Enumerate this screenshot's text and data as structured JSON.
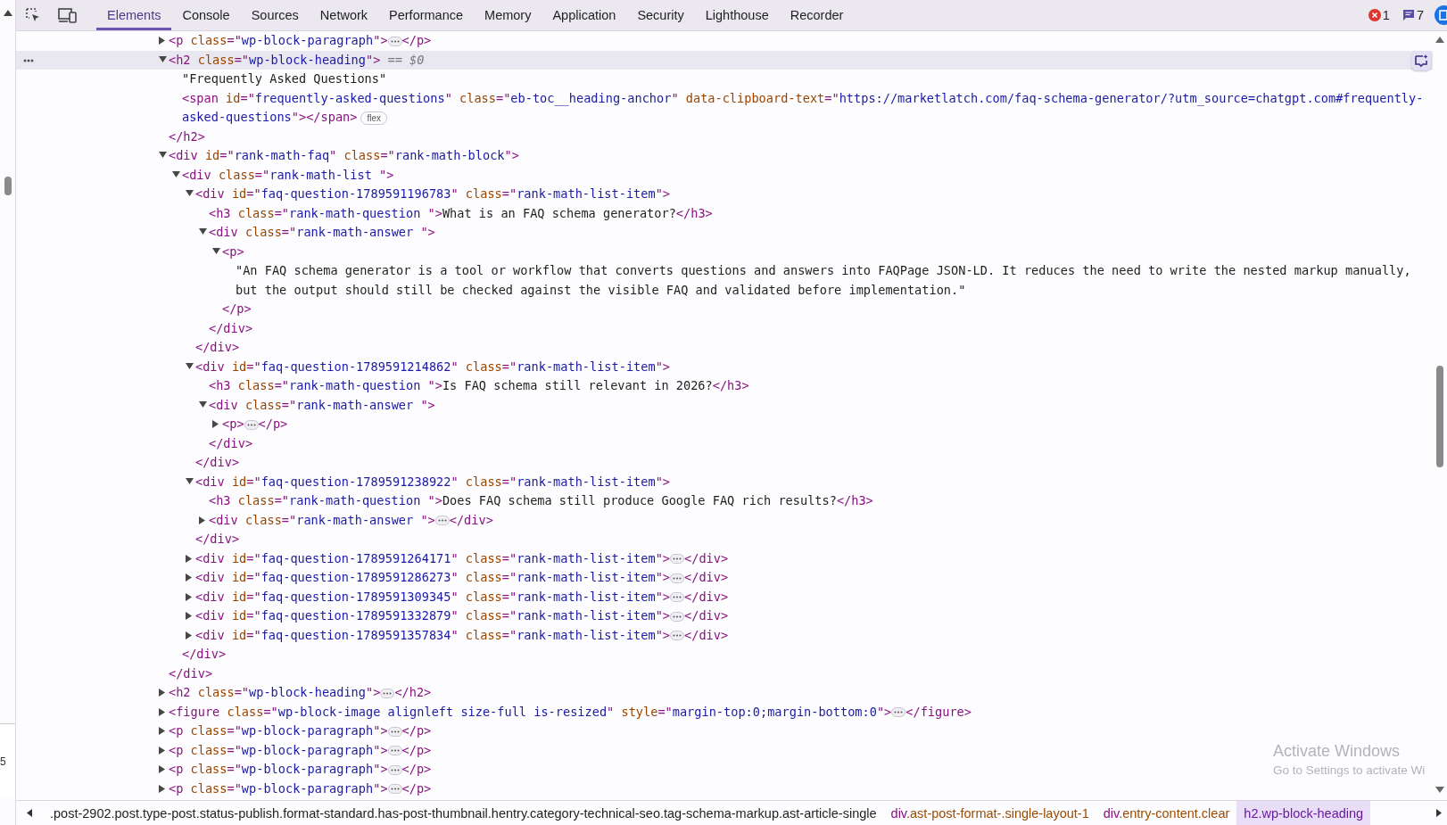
{
  "toolbar": {
    "tabs": [
      {
        "label": "Elements",
        "selected": true
      },
      {
        "label": "Console",
        "selected": false
      },
      {
        "label": "Sources",
        "selected": false
      },
      {
        "label": "Network",
        "selected": false
      },
      {
        "label": "Performance",
        "selected": false
      },
      {
        "label": "Memory",
        "selected": false
      },
      {
        "label": "Application",
        "selected": false
      },
      {
        "label": "Security",
        "selected": false
      },
      {
        "label": "Lighthouse",
        "selected": false
      },
      {
        "label": "Recorder",
        "selected": false
      }
    ],
    "errors": "1",
    "messages": "7"
  },
  "tree": [
    {
      "kind": "element",
      "open": "<p class=\"wp-block-paragraph\">",
      "close": "</p>",
      "expanded": false,
      "selected": false
    },
    {
      "kind": "element",
      "open": "<h2 class=\"wp-block-heading\">",
      "close": "</h2>",
      "expanded": true,
      "selected": true,
      "marker": "== $0",
      "children": [
        {
          "kind": "text",
          "text": "\"Frequently Asked Questions\"",
          "selected": false
        },
        {
          "kind": "inline",
          "open": "<span id=\"frequently-asked-questions\" class=\"eb-toc__heading-anchor\" data-clipboard-text=\"https://marketlatch.com/faq-schema-generator/?utm_source=chatgpt.com#frequently-asked-questions\">",
          "close": "</span>",
          "badge": "flex",
          "selected": false
        }
      ]
    },
    {
      "kind": "element",
      "open": "<div id=\"rank-math-faq\" class=\"rank-math-block\">",
      "close": "</div>",
      "expanded": true,
      "selected": false,
      "children": [
        {
          "kind": "element",
          "open": "<div class=\"rank-math-list \">",
          "close": "</div>",
          "expanded": true,
          "selected": false,
          "children": [
            {
              "kind": "element",
              "open": "<div id=\"faq-question-1789591196783\" class=\"rank-math-list-item\">",
              "close": "</div>",
              "expanded": true,
              "selected": false,
              "children": [
                {
                  "kind": "inline",
                  "open": "<h3 class=\"rank-math-question \">",
                  "text": "What is an FAQ schema generator?",
                  "close": "</h3>",
                  "selected": false
                },
                {
                  "kind": "element",
                  "open": "<div class=\"rank-math-answer \">",
                  "close": "</div>",
                  "expanded": true,
                  "selected": false,
                  "children": [
                    {
                      "kind": "element",
                      "open": "<p>",
                      "close": "</p>",
                      "expanded": true,
                      "selected": false,
                      "children": [
                        {
                          "kind": "text",
                          "text": "\"An FAQ schema generator is a tool or workflow that converts questions and answers into FAQPage JSON-LD. It reduces the need to write the nested markup manually, but the output should still be checked against the visible FAQ and validated before implementation.\"",
                          "selected": false
                        }
                      ]
                    }
                  ]
                }
              ]
            },
            {
              "kind": "element",
              "open": "<div id=\"faq-question-1789591214862\" class=\"rank-math-list-item\">",
              "close": "</div>",
              "expanded": true,
              "selected": false,
              "children": [
                {
                  "kind": "inline",
                  "open": "<h3 class=\"rank-math-question \">",
                  "text": "Is FAQ schema still relevant in 2026?",
                  "close": "</h3>",
                  "selected": false
                },
                {
                  "kind": "element",
                  "open": "<div class=\"rank-math-answer \">",
                  "close": "</div>",
                  "expanded": true,
                  "selected": false,
                  "children": [
                    {
                      "kind": "element",
                      "open": "<p>",
                      "close": "</p>",
                      "expanded": false,
                      "selected": false
                    }
                  ]
                }
              ]
            },
            {
              "kind": "element",
              "open": "<div id=\"faq-question-1789591238922\" class=\"rank-math-list-item\">",
              "close": "</div>",
              "expanded": true,
              "selected": false,
              "children": [
                {
                  "kind": "inline",
                  "open": "<h3 class=\"rank-math-question \">",
                  "text": "Does FAQ schema still produce Google FAQ rich results?",
                  "close": "</h3>",
                  "selected": false
                },
                {
                  "kind": "element",
                  "open": "<div class=\"rank-math-answer \">",
                  "close": "</div>",
                  "expanded": false,
                  "selected": false
                }
              ]
            },
            {
              "kind": "element",
              "open": "<div id=\"faq-question-1789591264171\" class=\"rank-math-list-item\">",
              "close": "</div>",
              "expanded": false,
              "selected": false
            },
            {
              "kind": "element",
              "open": "<div id=\"faq-question-1789591286273\" class=\"rank-math-list-item\">",
              "close": "</div>",
              "expanded": false,
              "selected": false
            },
            {
              "kind": "element",
              "open": "<div id=\"faq-question-1789591309345\" class=\"rank-math-list-item\">",
              "close": "</div>",
              "expanded": false,
              "selected": false
            },
            {
              "kind": "element",
              "open": "<div id=\"faq-question-1789591332879\" class=\"rank-math-list-item\">",
              "close": "</div>",
              "expanded": false,
              "selected": false
            },
            {
              "kind": "element",
              "open": "<div id=\"faq-question-1789591357834\" class=\"rank-math-list-item\">",
              "close": "</div>",
              "expanded": false,
              "selected": false
            }
          ]
        }
      ]
    },
    {
      "kind": "element",
      "open": "<h2 class=\"wp-block-heading\">",
      "close": "</h2>",
      "expanded": false,
      "selected": false
    },
    {
      "kind": "element",
      "open": "<figure class=\"wp-block-image alignleft size-full is-resized\" style=\"margin-top:0;margin-bottom:0\">",
      "close": "</figure>",
      "expanded": false,
      "selected": false
    },
    {
      "kind": "element",
      "open": "<p class=\"wp-block-paragraph\">",
      "close": "</p>",
      "expanded": false,
      "selected": false
    },
    {
      "kind": "element",
      "open": "<p class=\"wp-block-paragraph\">",
      "close": "</p>",
      "expanded": false,
      "selected": false
    },
    {
      "kind": "element",
      "open": "<p class=\"wp-block-paragraph\">",
      "close": "</p>",
      "expanded": false,
      "selected": false
    },
    {
      "kind": "element",
      "open": "<p class=\"wp-block-paragraph\">",
      "close": "</p>",
      "expanded": false,
      "selected": false
    }
  ],
  "breadcrumbs": [
    {
      "label": ".post-2902.post.type-post.status-publish.format-standard.has-post-thumbnail.hentry.category-technical-seo.tag-schema-markup.ast-article-single",
      "selected": false
    },
    {
      "tag": "div",
      "label": ".ast-post-format-.single-layout-1",
      "selected": false
    },
    {
      "tag": "div",
      "label": ".entry-content.clear",
      "selected": false
    },
    {
      "tag": "h2",
      "label": ".wp-block-heading",
      "selected": true
    }
  ],
  "side_fragment": "5",
  "os_notice": {
    "title": "Activate Windows",
    "subtitle": "Go to Settings to activate Wi"
  }
}
